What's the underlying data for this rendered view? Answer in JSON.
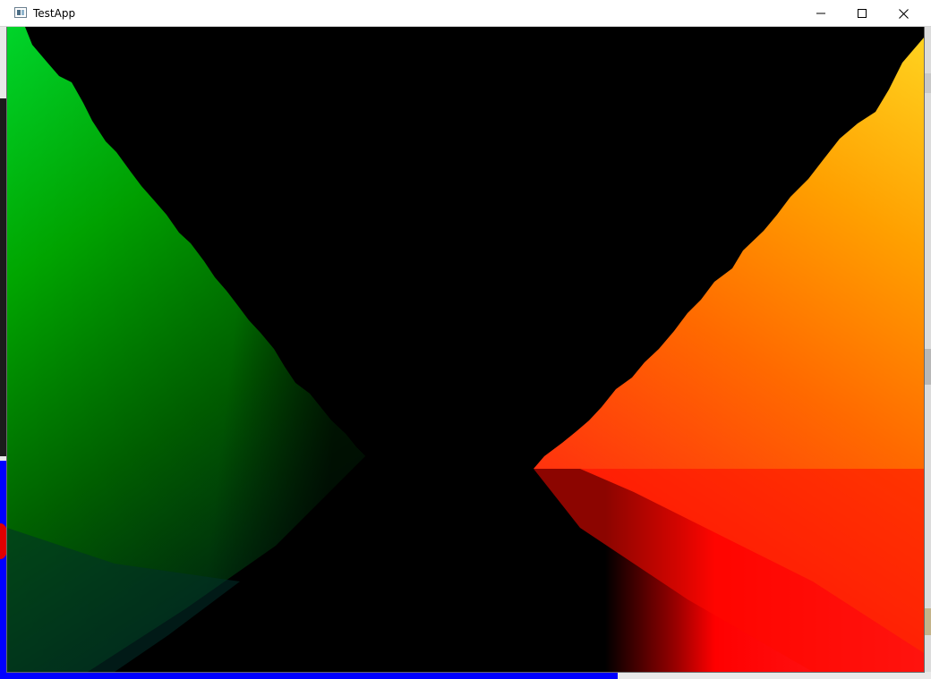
{
  "window": {
    "title": "TestApp",
    "controls": {
      "minimize": "minimize-icon",
      "maximize": "maximize-icon",
      "close": "close-icon"
    }
  },
  "scene": {
    "background_color": "#000000",
    "left_wall_colors": [
      "#00d42a",
      "#00a800",
      "#006400",
      "#002a10"
    ],
    "right_wall_colors": [
      "#ffd21f",
      "#ffa000",
      "#ff6a00",
      "#ff2a10"
    ],
    "floor_colors": [
      "#000000",
      "#9a0000",
      "#ff0000",
      "#ff2020"
    ]
  },
  "desktop": {
    "accent_blue": "#0000ff",
    "accent_red": "#e00000"
  }
}
